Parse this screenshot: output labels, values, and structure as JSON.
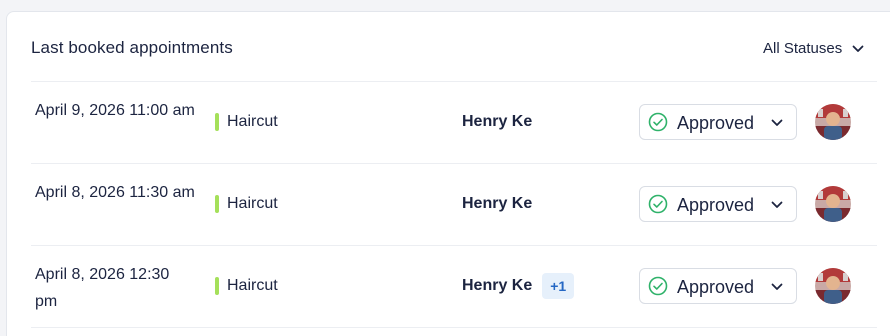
{
  "header": {
    "title": "Last booked appointments",
    "status_filter_label": "All Statuses"
  },
  "appointments": [
    {
      "date": "April 9, 2026 11:00 am",
      "service": "Haircut",
      "customer": "Henry Ke",
      "extra": "",
      "status": "Approved"
    },
    {
      "date": "April 8, 2026 11:30 am",
      "service": "Haircut",
      "customer": "Henry Ke",
      "extra": "",
      "status": "Approved"
    },
    {
      "date": "April 8, 2026 12:30 pm",
      "service": "Haircut",
      "customer": "Henry Ke",
      "extra": "+1",
      "status": "Approved"
    }
  ],
  "icons": {
    "status": "check-circle-icon",
    "dropdown": "chevron-down-icon",
    "avatar": "user-avatar"
  },
  "colors": {
    "service_bar": "#a5e05a",
    "approved_check": "#2fb26a",
    "more_badge_bg": "#e6f0fb",
    "more_badge_text": "#2467c4"
  }
}
